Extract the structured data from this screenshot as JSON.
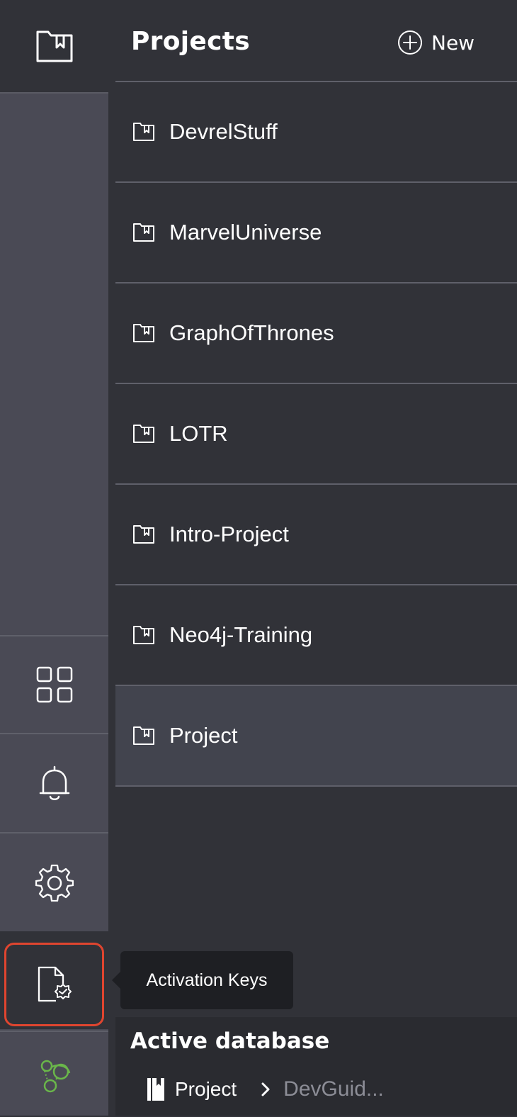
{
  "sidebar": {
    "items": [
      {
        "icon": "projects-folder-icon"
      },
      {
        "icon": "apps-grid-icon"
      },
      {
        "icon": "notifications-bell-icon"
      },
      {
        "icon": "settings-gear-icon"
      },
      {
        "icon": "activation-keys-icon"
      },
      {
        "icon": "neo4j-logo-icon"
      }
    ]
  },
  "header": {
    "title": "Projects",
    "new_label": "New"
  },
  "projects": [
    {
      "name": "DevrelStuff"
    },
    {
      "name": "MarvelUniverse"
    },
    {
      "name": "GraphOfThrones"
    },
    {
      "name": "LOTR"
    },
    {
      "name": "Intro-Project"
    },
    {
      "name": "Neo4j-Training"
    },
    {
      "name": "Project"
    }
  ],
  "selected_project": "Project",
  "tooltip": {
    "text": "Activation Keys"
  },
  "footer": {
    "heading": "Active database",
    "project": "Project",
    "database": "DevGuid..."
  },
  "colors": {
    "accent_highlight": "#e0452f",
    "neo4j_green": "#6ab64a"
  }
}
